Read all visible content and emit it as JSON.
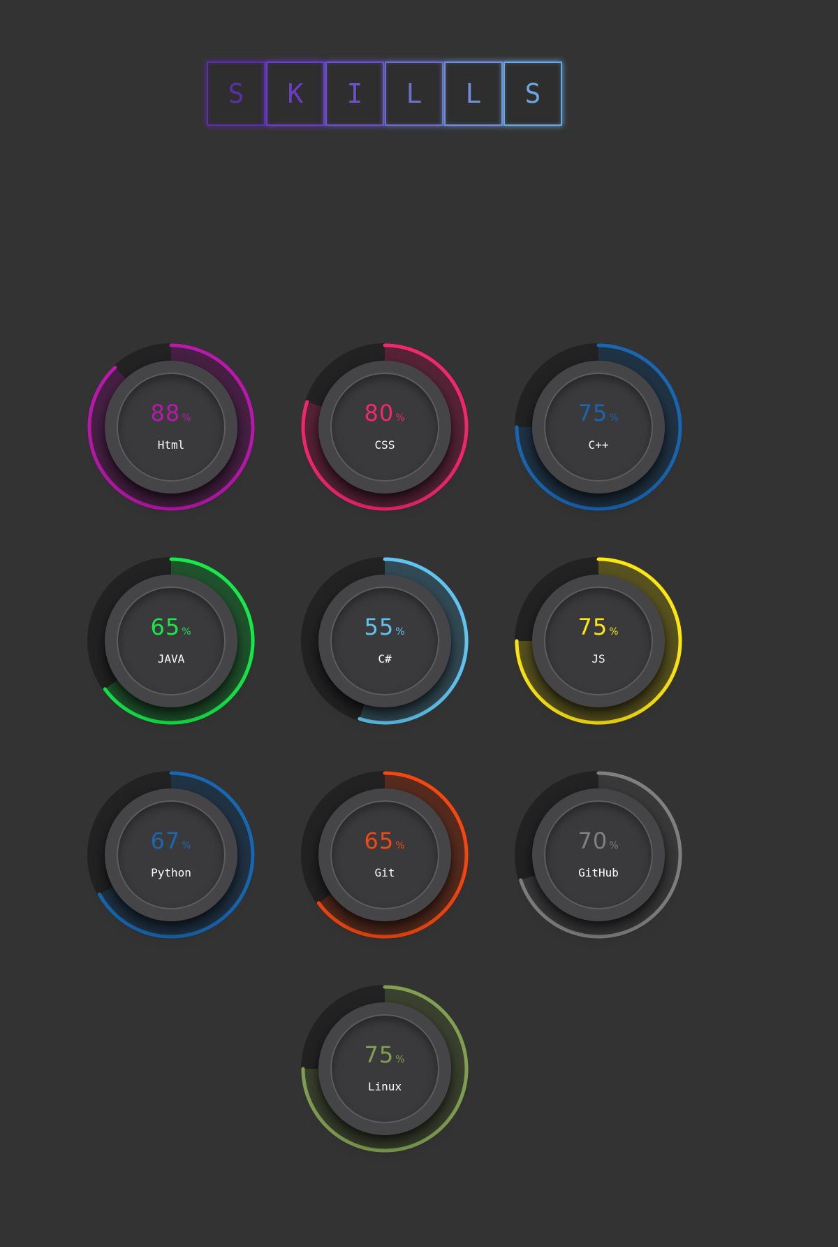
{
  "title": {
    "letters": [
      {
        "char": "S",
        "color": "#5a2fa8"
      },
      {
        "char": "K",
        "color": "#6a3dc6"
      },
      {
        "char": "I",
        "color": "#6a52c8"
      },
      {
        "char": "L",
        "color": "#6a70c8"
      },
      {
        "char": "L",
        "color": "#6e8ed6"
      },
      {
        "char": "S",
        "color": "#6aa6e0"
      }
    ]
  },
  "skills": [
    {
      "name": "Html",
      "percent": "88",
      "unit": "%",
      "value": 88,
      "color": "#b51aa8"
    },
    {
      "name": "CSS",
      "percent": "80",
      "unit": "%",
      "value": 80,
      "color": "#f0286e"
    },
    {
      "name": "C++",
      "percent": "75",
      "unit": "%",
      "value": 75,
      "color": "#1a67b0"
    },
    {
      "name": "JAVA",
      "percent": "65",
      "unit": "%",
      "value": 65,
      "color": "#18e84a"
    },
    {
      "name": "C#",
      "percent": "55",
      "unit": "%",
      "value": 55,
      "color": "#62c4ee"
    },
    {
      "name": "JS",
      "percent": "75",
      "unit": "%",
      "value": 75,
      "color": "#fce514"
    },
    {
      "name": "Python",
      "percent": "67",
      "unit": "%",
      "value": 67,
      "color": "#1a67b0"
    },
    {
      "name": "Git",
      "percent": "65",
      "unit": "%",
      "value": 65,
      "color": "#f24812"
    },
    {
      "name": "GitHub",
      "percent": "70",
      "unit": "%",
      "value": 70,
      "color": "#808080"
    },
    {
      "name": "Linux",
      "percent": "75",
      "unit": "%",
      "value": 75,
      "color": "#82a052"
    }
  ]
}
